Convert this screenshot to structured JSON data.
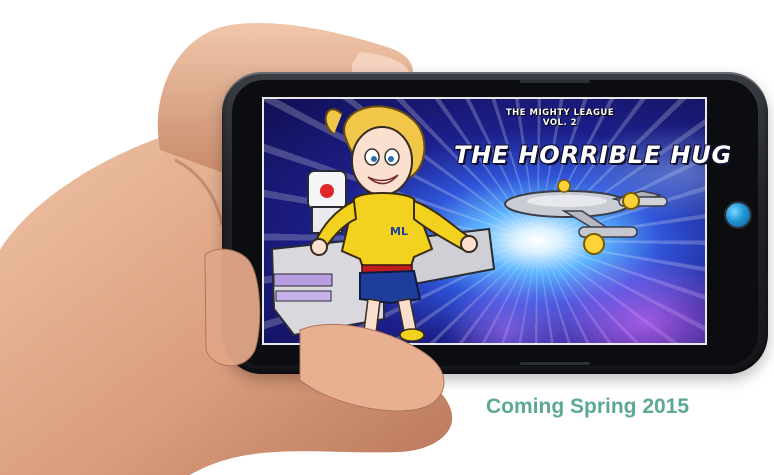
{
  "screen": {
    "subtitle_line1": "THE MIGHTY LEAGUE",
    "subtitle_line2": "VOL. 2",
    "title": "THE HORRIBLE HUG",
    "emblem": "ML"
  },
  "caption": "Coming Spring 2015",
  "colors": {
    "caption": "#5ba995",
    "phone_button": "#1e96d6",
    "shirt": "#f2d21e"
  }
}
